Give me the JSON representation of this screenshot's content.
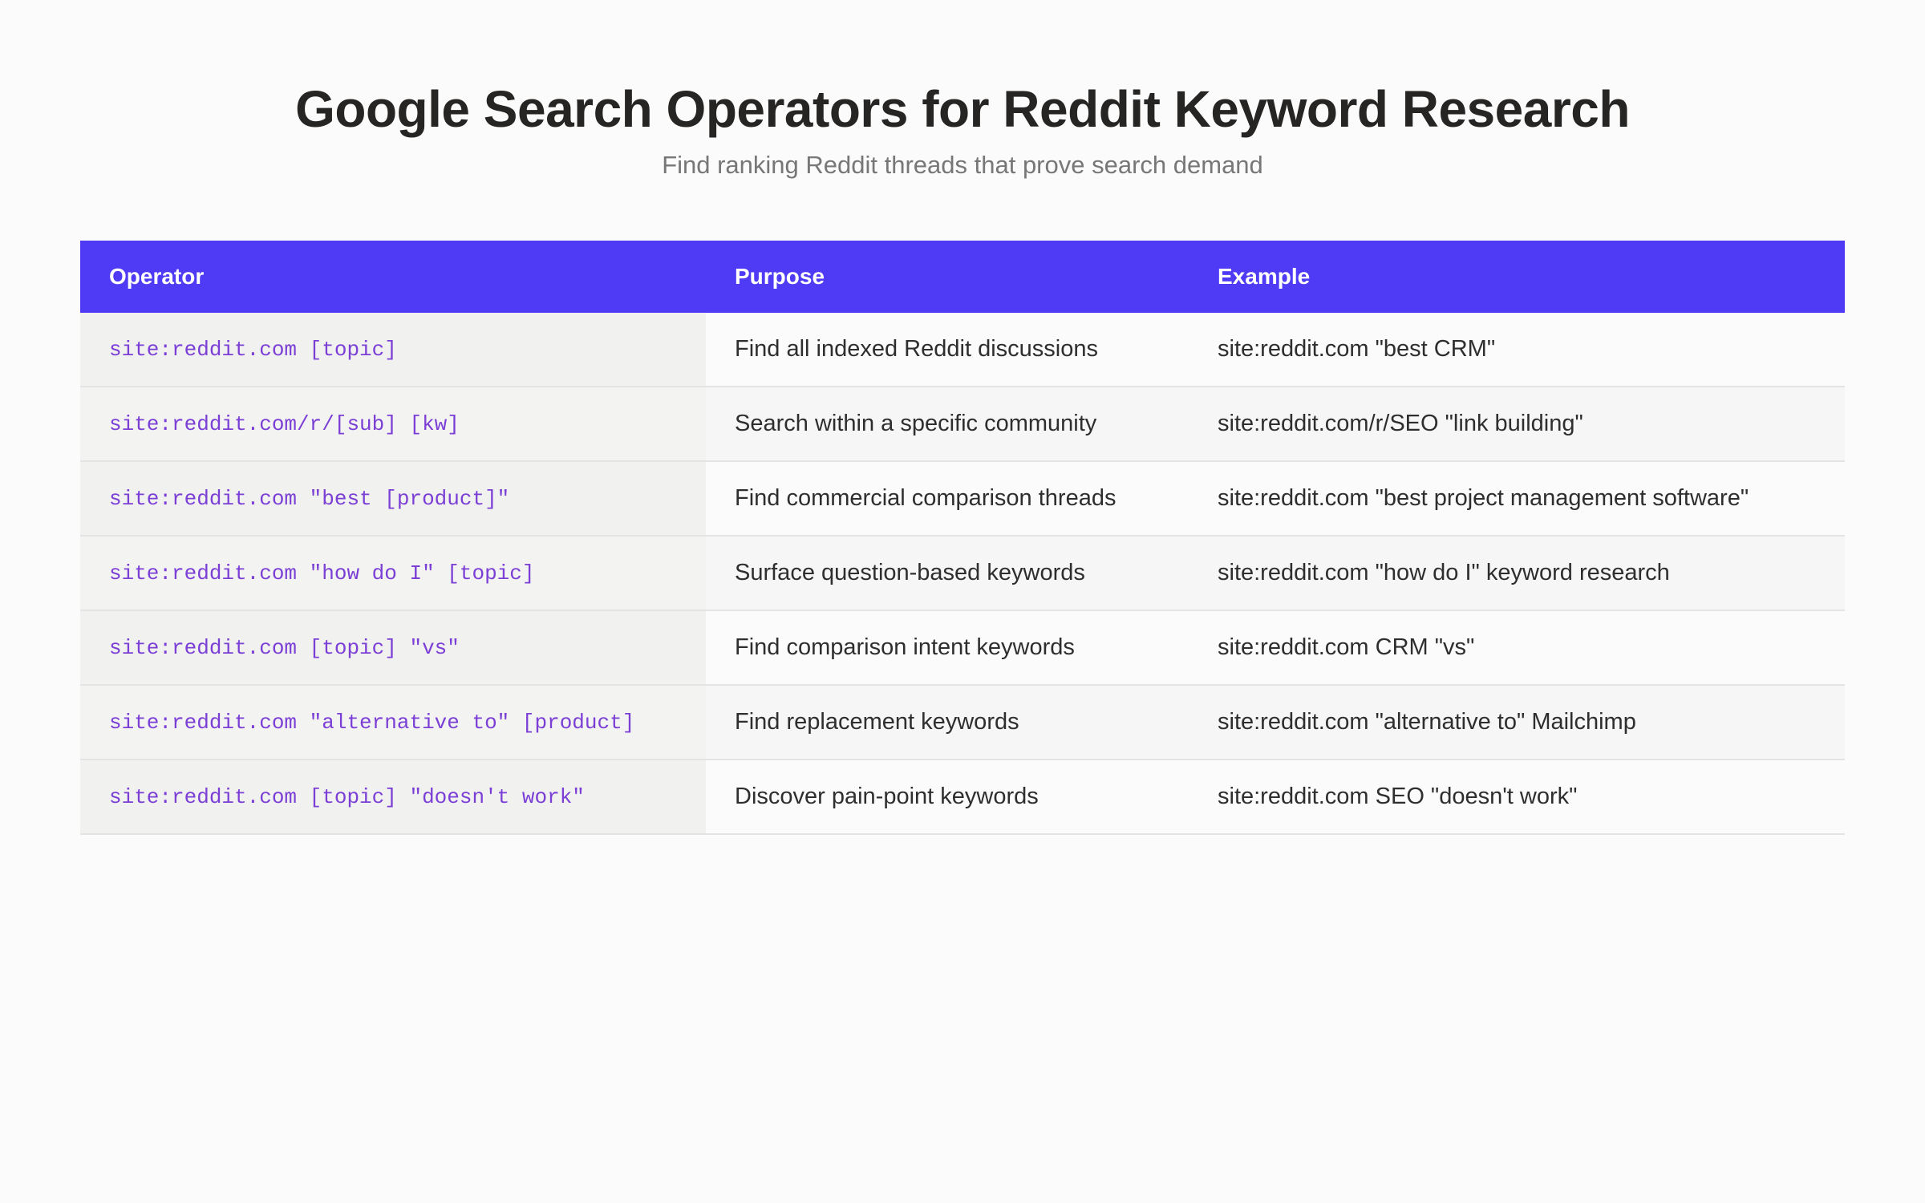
{
  "header": {
    "title": "Google Search Operators for Reddit Keyword Research",
    "subtitle": "Find ranking Reddit threads that prove search demand"
  },
  "table": {
    "columns": [
      "Operator",
      "Purpose",
      "Example"
    ],
    "rows": [
      {
        "operator": "site:reddit.com [topic]",
        "purpose": "Find all indexed Reddit discussions",
        "example": "site:reddit.com \"best CRM\""
      },
      {
        "operator": "site:reddit.com/r/[sub] [kw]",
        "purpose": "Search within a specific community",
        "example": "site:reddit.com/r/SEO \"link building\""
      },
      {
        "operator": "site:reddit.com \"best [product]\"",
        "purpose": "Find commercial comparison threads",
        "example": "site:reddit.com \"best project management software\""
      },
      {
        "operator": "site:reddit.com \"how do I\" [topic]",
        "purpose": "Surface question-based keywords",
        "example": "site:reddit.com \"how do I\" keyword research"
      },
      {
        "operator": "site:reddit.com [topic] \"vs\"",
        "purpose": "Find comparison intent keywords",
        "example": "site:reddit.com CRM \"vs\""
      },
      {
        "operator": "site:reddit.com \"alternative to\" [product]",
        "purpose": "Find replacement keywords",
        "example": "site:reddit.com \"alternative to\" Mailchimp"
      },
      {
        "operator": "site:reddit.com [topic] \"doesn't work\"",
        "purpose": "Discover pain-point keywords",
        "example": "site:reddit.com SEO \"doesn't work\""
      }
    ]
  },
  "colors": {
    "header_bg": "#4f3af5",
    "header_text": "#ffffff",
    "operator_text": "#7b3fd6",
    "title_text": "#262523",
    "subtitle_text": "#777777",
    "page_bg": "#fbfbfb"
  }
}
